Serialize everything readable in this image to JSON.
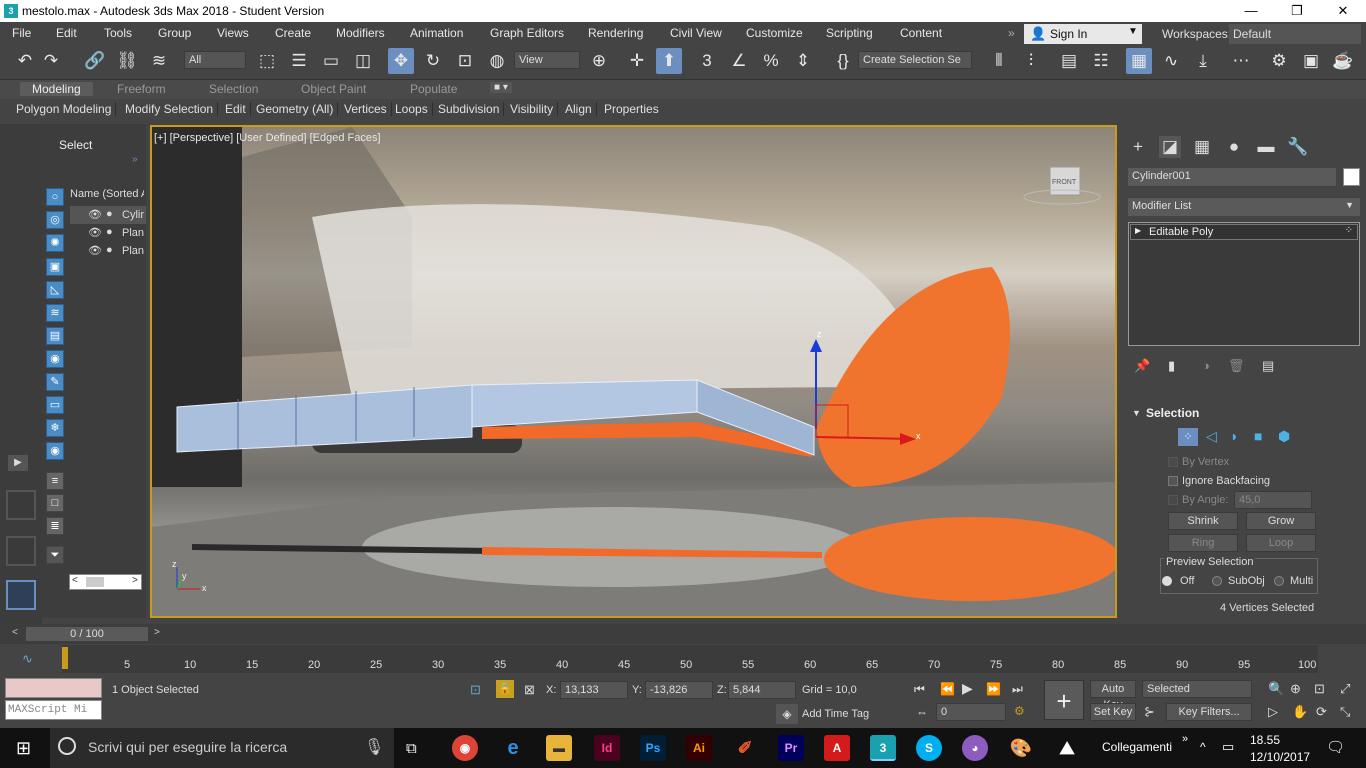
{
  "window": {
    "title": "mestolo.max - Autodesk 3ds Max 2018 - Student Version",
    "app_icon": "3"
  },
  "menu": [
    "File",
    "Edit",
    "Tools",
    "Group",
    "Views",
    "Create",
    "Modifiers",
    "Animation",
    "Graph Editors",
    "Rendering",
    "Civil View",
    "Customize",
    "Scripting",
    "Content"
  ],
  "account": {
    "signin": "Sign In",
    "workspaces_label": "Workspaces:",
    "workspace": "Default"
  },
  "toolbar": {
    "filter": "All",
    "refcoord": "View",
    "selection_set": "Create Selection Se"
  },
  "ribbon_tabs": [
    "Modeling",
    "Freeform",
    "Selection",
    "Object Paint",
    "Populate"
  ],
  "ribbon_items": [
    "Polygon Modeling",
    "Modify Selection",
    "Edit",
    "Geometry (All)",
    "Vertices",
    "Loops",
    "Subdivision",
    "Visibility",
    "Align",
    "Properties"
  ],
  "scene_explorer": {
    "title": "Select",
    "column": "Name (Sorted A",
    "items": [
      "Cylir",
      "Plan",
      "Plan"
    ]
  },
  "viewport": {
    "label": "[+] [Perspective] [User Defined] [Edged Faces]",
    "viewcube": "FRONT",
    "axis_z": "z",
    "axis_x": "x",
    "axis_y": "y"
  },
  "command_panel": {
    "object_name": "Cylinder001",
    "modifier_list": "Modifier List",
    "stack": [
      "Editable Poly"
    ],
    "selection": {
      "header": "Selection",
      "by_vertex": "By Vertex",
      "ignore_backfacing": "Ignore Backfacing",
      "by_angle": "By Angle:",
      "angle_value": "45,0",
      "shrink": "Shrink",
      "grow": "Grow",
      "ring": "Ring",
      "loop": "Loop",
      "preview_title": "Preview Selection",
      "preview_options": [
        "Off",
        "SubObj",
        "Multi"
      ],
      "status": "4 Vertices Selected"
    }
  },
  "timeline": {
    "frame": "0 / 100",
    "ticks": [
      "5",
      "10",
      "15",
      "20",
      "25",
      "30",
      "35",
      "40",
      "45",
      "50",
      "55",
      "60",
      "65",
      "70",
      "75",
      "80",
      "85",
      "90",
      "95",
      "100"
    ]
  },
  "status": {
    "maxscript": "MAXScript Mi",
    "objects_selected": "1 Object Selected",
    "x_label": "X:",
    "x_value": "13,133",
    "y_label": "Y:",
    "y_value": "-13,826",
    "z_label": "Z:",
    "z_value": "5,844",
    "grid": "Grid = 10,0",
    "add_time_tag": "Add Time Tag",
    "auto_key": "Auto Key",
    "set_key": "Set Key",
    "key_mode": "Selected",
    "key_filters": "Key Filters...",
    "current_frame": "0"
  },
  "taskbar": {
    "search": "Scrivi qui per eseguire la ricerca",
    "tray_label": "Collegamenti",
    "time": "18.55",
    "date": "12/10/2017"
  }
}
